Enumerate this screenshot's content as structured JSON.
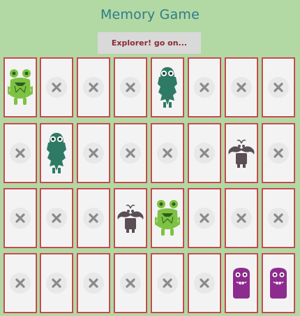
{
  "title": "Memory Game",
  "status": "Explorer! go on...",
  "colors": {
    "background": "#b2d8a4",
    "card_border": "#c9484f",
    "title": "#2e7d87"
  },
  "grid": {
    "rows": 4,
    "cols": 8,
    "cards": [
      {
        "row": 0,
        "col": 0,
        "state": "face-up",
        "icon": "green-frog-monster-icon"
      },
      {
        "row": 0,
        "col": 1,
        "state": "face-down",
        "icon": "x-icon"
      },
      {
        "row": 0,
        "col": 2,
        "state": "face-down",
        "icon": "x-icon"
      },
      {
        "row": 0,
        "col": 3,
        "state": "face-down",
        "icon": "x-icon"
      },
      {
        "row": 0,
        "col": 4,
        "state": "face-up",
        "icon": "bearded-monster-icon"
      },
      {
        "row": 0,
        "col": 5,
        "state": "face-down",
        "icon": "x-icon"
      },
      {
        "row": 0,
        "col": 6,
        "state": "face-down",
        "icon": "x-icon"
      },
      {
        "row": 0,
        "col": 7,
        "state": "face-down",
        "icon": "x-icon"
      },
      {
        "row": 1,
        "col": 0,
        "state": "face-down",
        "icon": "x-icon"
      },
      {
        "row": 1,
        "col": 1,
        "state": "face-up",
        "icon": "bearded-monster-icon"
      },
      {
        "row": 1,
        "col": 2,
        "state": "face-down",
        "icon": "x-icon"
      },
      {
        "row": 1,
        "col": 3,
        "state": "face-down",
        "icon": "x-icon"
      },
      {
        "row": 1,
        "col": 4,
        "state": "face-down",
        "icon": "x-icon"
      },
      {
        "row": 1,
        "col": 5,
        "state": "face-down",
        "icon": "x-icon"
      },
      {
        "row": 1,
        "col": 6,
        "state": "face-up",
        "icon": "mustache-monster-icon"
      },
      {
        "row": 1,
        "col": 7,
        "state": "face-down",
        "icon": "x-icon"
      },
      {
        "row": 2,
        "col": 0,
        "state": "face-down",
        "icon": "x-icon"
      },
      {
        "row": 2,
        "col": 1,
        "state": "face-down",
        "icon": "x-icon"
      },
      {
        "row": 2,
        "col": 2,
        "state": "face-down",
        "icon": "x-icon"
      },
      {
        "row": 2,
        "col": 3,
        "state": "face-up",
        "icon": "mustache-monster-icon"
      },
      {
        "row": 2,
        "col": 4,
        "state": "face-up",
        "icon": "green-frog-monster-icon"
      },
      {
        "row": 2,
        "col": 5,
        "state": "face-down",
        "icon": "x-icon"
      },
      {
        "row": 2,
        "col": 6,
        "state": "face-down",
        "icon": "x-icon"
      },
      {
        "row": 2,
        "col": 7,
        "state": "face-down",
        "icon": "x-icon"
      },
      {
        "row": 3,
        "col": 0,
        "state": "face-down",
        "icon": "x-icon"
      },
      {
        "row": 3,
        "col": 1,
        "state": "face-down",
        "icon": "x-icon"
      },
      {
        "row": 3,
        "col": 2,
        "state": "face-down",
        "icon": "x-icon"
      },
      {
        "row": 3,
        "col": 3,
        "state": "face-down",
        "icon": "x-icon"
      },
      {
        "row": 3,
        "col": 4,
        "state": "face-down",
        "icon": "x-icon"
      },
      {
        "row": 3,
        "col": 5,
        "state": "face-down",
        "icon": "x-icon"
      },
      {
        "row": 3,
        "col": 6,
        "state": "face-up",
        "icon": "purple-blob-monster-icon"
      },
      {
        "row": 3,
        "col": 7,
        "state": "face-up",
        "icon": "purple-blob-monster-icon"
      }
    ]
  }
}
